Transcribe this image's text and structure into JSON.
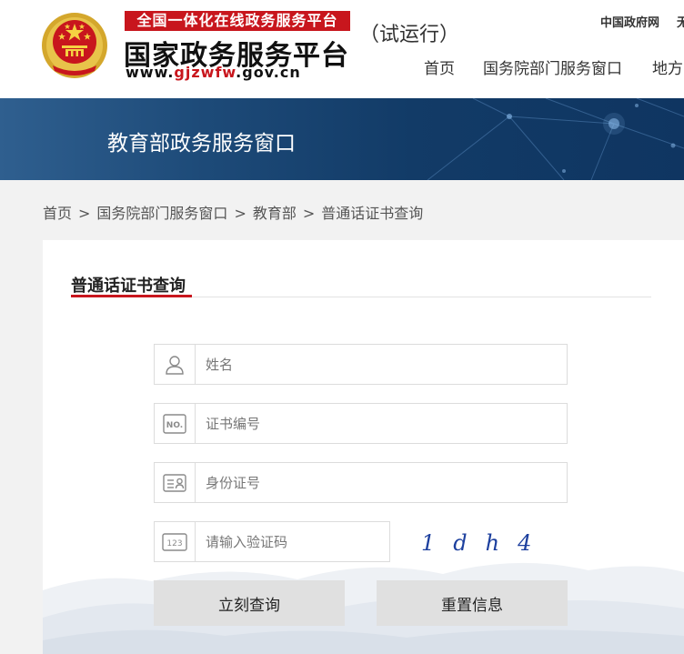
{
  "header": {
    "ribbon": "全国一体化在线政务服务平台",
    "title": "国家政务服务平台",
    "url_prefix": "www.",
    "url_highlight": "gjzwfw",
    "url_suffix": ".gov.cn",
    "trial_label": "（试运行）",
    "top_links": [
      "中国政府网",
      "无"
    ],
    "nav": [
      "首页",
      "国务院部门服务窗口",
      "地方"
    ]
  },
  "banner": {
    "title": "教育部政务服务窗口"
  },
  "breadcrumb": [
    "首页",
    "国务院部门服务窗口",
    "教育部",
    "普通话证书查询"
  ],
  "breadcrumb_separator": ">",
  "form": {
    "heading": "普通话证书查询",
    "fields": [
      {
        "icon": "user-icon",
        "placeholder": "姓名",
        "value": ""
      },
      {
        "icon": "certificate-number-icon",
        "placeholder": "证书编号",
        "value": "",
        "icon_text": "NO."
      },
      {
        "icon": "id-card-icon",
        "placeholder": "身份证号",
        "value": ""
      },
      {
        "icon": "captcha-code-icon",
        "placeholder": "请输入验证码",
        "value": "",
        "icon_text": "123"
      }
    ],
    "captcha_text": "1dh4",
    "buttons": {
      "query": "立刻查询",
      "reset": "重置信息"
    }
  },
  "colors": {
    "brand_red": "#c8161d",
    "banner_blue": "#123b67",
    "button_gray": "#e0e0e0"
  }
}
